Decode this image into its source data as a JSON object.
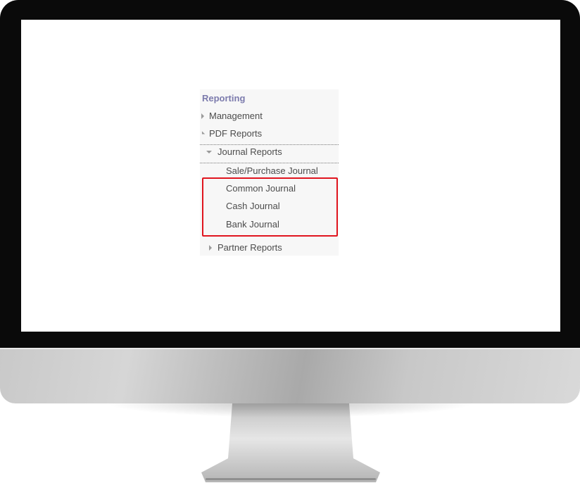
{
  "menu": {
    "header": "Reporting",
    "items": [
      {
        "label": "Management"
      },
      {
        "label": "PDF Reports"
      },
      {
        "label": "Journal Reports"
      },
      {
        "label": "Sale/Purchase Journal"
      },
      {
        "label": "Common Journal"
      },
      {
        "label": "Cash Journal"
      },
      {
        "label": "Bank Journal"
      },
      {
        "label": "Partner Reports"
      }
    ]
  },
  "colors": {
    "header": "#7c7bad",
    "highlight": "#e0141e",
    "bezel": "#0a0a0a"
  }
}
